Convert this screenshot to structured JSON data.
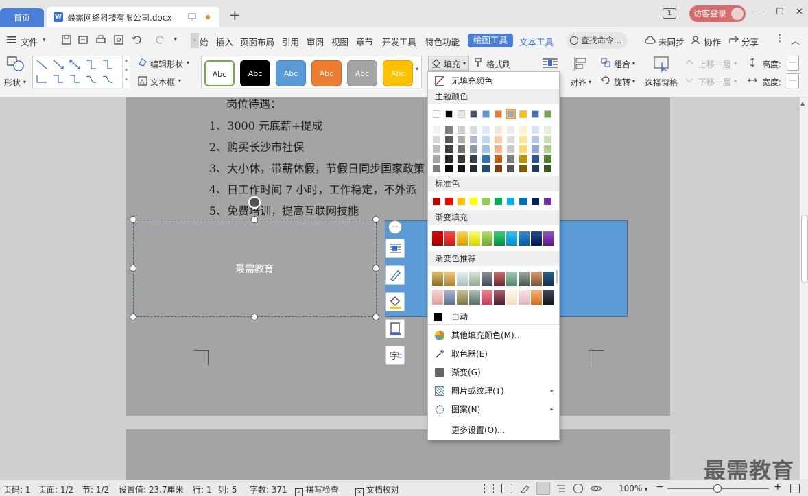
{
  "titlebar": {
    "home_tab": "首页",
    "doc_tab": "最需网络科技有限公司.docx",
    "new_tab": "+",
    "page_badge": "1",
    "login": "访客登录",
    "minimize": "—",
    "maximize": "☐",
    "close": "✕"
  },
  "menubar": {
    "file": "文件",
    "items": [
      "始",
      "插入",
      "页面布局",
      "引用",
      "审阅",
      "视图",
      "章节",
      "开发工具",
      "特色功能"
    ],
    "active_tab": "绘图工具",
    "text_tools": "文本工具",
    "search": "查找命令...",
    "sync": "未同步",
    "collab": "协作",
    "share": "分享"
  },
  "ribbon": {
    "shape": "形状",
    "edit_shape": "编辑形状",
    "textbox": "文本框",
    "abc": "Abc",
    "fill": "填充",
    "format_brush": "格式刷",
    "align": "对齐",
    "group": "组合",
    "rotate": "旋转",
    "selection_pane": "选择窗格",
    "bring_forward": "上移一层",
    "send_backward": "下移一层",
    "height": "高度:",
    "width": "宽度:",
    "style_colors": [
      {
        "bg": "#ffffff",
        "fg": "#222222",
        "border": "#70ad47"
      },
      {
        "bg": "#000000",
        "fg": "#ffffff",
        "border": "#000000"
      },
      {
        "bg": "#5b9bd5",
        "fg": "#ffffff",
        "border": "#4a86c0"
      },
      {
        "bg": "#ed7d31",
        "fg": "#ffffff",
        "border": "#d46a22"
      },
      {
        "bg": "#a5a5a5",
        "fg": "#ffffff",
        "border": "#8f8f8f"
      },
      {
        "bg": "#ffc000",
        "fg": "#ffffff",
        "border": "#e0a800"
      }
    ]
  },
  "document": {
    "lines": [
      "岗位待遇：",
      "1、3000 元底薪+提成",
      "2、购买长沙市社保",
      "3、大小休，带薪休假，节假日同步国家政策",
      "4、日工作时间 7 小时，工作稳定，不外派",
      "5、免费培训，提高互联网技能"
    ],
    "selected_box_text": "最需教育"
  },
  "fill_menu": {
    "no_fill": "无填充颜色",
    "theme_colors_title": "主题颜色",
    "theme_top": [
      "#ffffff",
      "#000000",
      "#e7e6e6",
      "#44546a",
      "#5b9bd5",
      "#ed7d31",
      "#a5a5a5",
      "#ffc000",
      "#4472c4",
      "#70ad47"
    ],
    "theme_shades": [
      [
        "#f2f2f2",
        "#7f7f7f",
        "#d0cece",
        "#d6dce4",
        "#deebf6",
        "#fbe5d5",
        "#ededed",
        "#fff2cc",
        "#dae3f3",
        "#e2efd9"
      ],
      [
        "#d8d8d8",
        "#595959",
        "#aeaaaa",
        "#adb9ca",
        "#bdd7ee",
        "#f7cbac",
        "#dbdbdb",
        "#fee599",
        "#b4c6e7",
        "#c5e0b3"
      ],
      [
        "#bfbfbf",
        "#3f3f3f",
        "#757070",
        "#8496b0",
        "#9cc3e5",
        "#f4b183",
        "#c9c9c9",
        "#ffd965",
        "#8eaadb",
        "#a8d08d"
      ],
      [
        "#a5a5a5",
        "#262626",
        "#3a3838",
        "#323f4f",
        "#2e75b5",
        "#c55a11",
        "#7b7b7b",
        "#bf9000",
        "#2f5496",
        "#538135"
      ],
      [
        "#7f7f7f",
        "#0c0c0c",
        "#171616",
        "#222a35",
        "#1e4e79",
        "#843c0b",
        "#525252",
        "#7f6000",
        "#1f3864",
        "#375623"
      ]
    ],
    "standard_title": "标准色",
    "standard": [
      "#c00000",
      "#ff0000",
      "#ffc000",
      "#ffff00",
      "#92d050",
      "#00b050",
      "#00b0f0",
      "#0070c0",
      "#002060",
      "#7030a0"
    ],
    "gradient_title": "渐变填充",
    "gradient": [
      [
        "#e00000",
        "#a00000"
      ],
      [
        "#ff4a4a",
        "#c81e1e"
      ],
      [
        "#ffd24a",
        "#d9a000"
      ],
      [
        "#ffff66",
        "#d8d800"
      ],
      [
        "#b4e26e",
        "#6ea830"
      ],
      [
        "#3ccf7a",
        "#009040"
      ],
      [
        "#2fc5f5",
        "#008cc8"
      ],
      [
        "#3a8ad8",
        "#005aa0"
      ],
      [
        "#2a4a9a",
        "#001850"
      ],
      [
        "#9a56c8",
        "#5a1888"
      ]
    ],
    "gradient_rec_title": "渐变色推荐",
    "gradient_rec": [
      [
        [
          "#e0c070",
          "#8a6a20"
        ],
        [
          "#f0c880",
          "#b08030"
        ],
        [
          "#e8f0f0",
          "#a8c0c0"
        ],
        [
          "#d8e8d8",
          "#90a890"
        ],
        [
          "#909090",
          "#404860"
        ],
        [
          "#c87070",
          "#702828"
        ],
        [
          "#a0c8b0",
          "#508868"
        ],
        [
          "#a0a8a0",
          "#485848"
        ],
        [
          "#d89870",
          "#805030"
        ],
        [
          "#306080",
          "#103050"
        ]
      ],
      [
        [
          "#f8d0d0",
          "#e0a0a0"
        ],
        [
          "#a8b8d0",
          "#607090"
        ],
        [
          "#c8c090",
          "#807848"
        ],
        [
          "#b0c0b8",
          "#587068"
        ],
        [
          "#f08090",
          "#c04058"
        ],
        [
          "#a86070",
          "#502030"
        ],
        [
          "#fff8e8",
          "#f0e0c0"
        ],
        [
          "#f8e0e0",
          "#e0b8c0"
        ],
        [
          "#f8b070",
          "#d07020"
        ],
        [
          "#404858",
          "#101820"
        ]
      ]
    ],
    "auto": "自动",
    "more_fill": "其他填充颜色(M)...",
    "eyedropper": "取色器(E)",
    "gradient_item": "渐变(G)",
    "picture_texture": "图片或纹理(T)",
    "pattern": "图案(N)",
    "more_settings": "更多设置(O)..."
  },
  "statusbar": {
    "page_num": "页码: 1",
    "page": "页面: 1/2",
    "section": "节: 1/2",
    "setting": "设置值: 23.7厘米",
    "row": "行: 1",
    "col": "列: 5",
    "words": "字数: 371",
    "spellcheck": "拼写检查",
    "proof": "文档校对",
    "zoom": "100%"
  },
  "watermark": "最需教育"
}
